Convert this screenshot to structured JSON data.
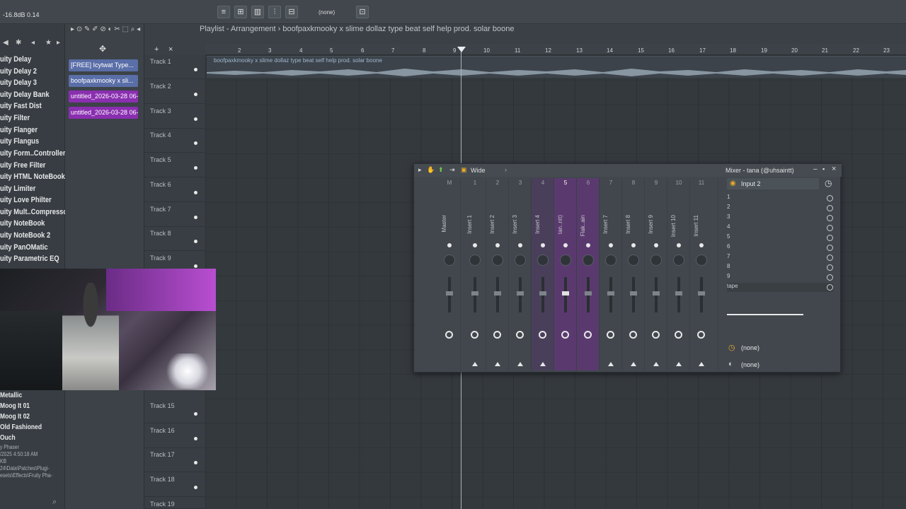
{
  "topbar": {
    "readout": "-16.8dB 0.14",
    "pattern": "(none)"
  },
  "browser": {
    "items": [
      "uity Delay",
      "uity Delay 2",
      "uity Delay 3",
      "uity Delay Bank",
      "uity Fast Dist",
      "uity Filter",
      "uity Flanger",
      "uity Flangus",
      "uity Form..Controller",
      "uity Free Filter",
      "uity HTML NoteBook",
      "uity Limiter",
      "uity Love Philter",
      "uity Mult..Compressor",
      "uity NoteBook",
      "uity NoteBook 2",
      "uity PanOMatic",
      "uity Parametric EQ"
    ],
    "lower_items": [
      "Metallic",
      "Moog It 01",
      "Moog It 02",
      "Old Fashioned",
      "Ouch"
    ],
    "info": [
      "y Phaser",
      "/2025 4:50:18 AM",
      "KB",
      "24\\Data\\Patches\\Plugi-",
      "esets\\Effects\\Fruity Pha-"
    ]
  },
  "picker": {
    "clips": [
      {
        "label": "[FREE] Icytwat Type...",
        "color": "#5a6ea8"
      },
      {
        "label": "boofpaxkmooky x sli...",
        "color": "#5a6ea8"
      },
      {
        "label": "untitled_2026-03-28 06-...",
        "color": "#8a2fb0"
      },
      {
        "label": "untitled_2026-03-28 06-...",
        "color": "#8a2fb0"
      }
    ]
  },
  "playlist": {
    "title": "Playlist - Arrangement › boofpaxkmooky x slime dollaz type beat self help prod. solar boone",
    "clip_name": "boofpaxkmooky x slime dollaz type beat self help prod. solar boone",
    "ruler": [
      "2",
      "3",
      "4",
      "5",
      "6",
      "7",
      "8",
      "9",
      "10",
      "11",
      "12",
      "13",
      "14",
      "15",
      "16",
      "17",
      "18",
      "19",
      "20",
      "21",
      "22",
      "23"
    ],
    "tracks": [
      "Track 1",
      "Track 2",
      "Track 3",
      "Track 4",
      "Track 5",
      "Track 6",
      "Track 7",
      "Track 8",
      "Track 9",
      "Track 15",
      "Track 16",
      "Track 17",
      "Track 18",
      "Track 19"
    ]
  },
  "mixer": {
    "preset": "Wide",
    "title": "Mixer - tana (@uhsaintt)",
    "input": "Input 2",
    "strips": [
      {
        "num": "M",
        "name": "Master"
      },
      {
        "num": "1",
        "name": "Insert 1"
      },
      {
        "num": "2",
        "name": "Insert 2"
      },
      {
        "num": "3",
        "name": "Insert 3"
      },
      {
        "num": "4",
        "name": "Insert 4"
      },
      {
        "num": "5",
        "name": "tan..ntt)"
      },
      {
        "num": "6",
        "name": "Flak..ain"
      },
      {
        "num": "7",
        "name": "Insert 7"
      },
      {
        "num": "8",
        "name": "Insert 8"
      },
      {
        "num": "9",
        "name": "Insert 9"
      },
      {
        "num": "10",
        "name": "Insert 10"
      },
      {
        "num": "11",
        "name": "Insert 11"
      }
    ],
    "routes": [
      "1",
      "2",
      "3",
      "4",
      "5",
      "6",
      "7",
      "8",
      "9",
      "tape"
    ],
    "slot1": "(none)",
    "slot2": "(none)"
  }
}
